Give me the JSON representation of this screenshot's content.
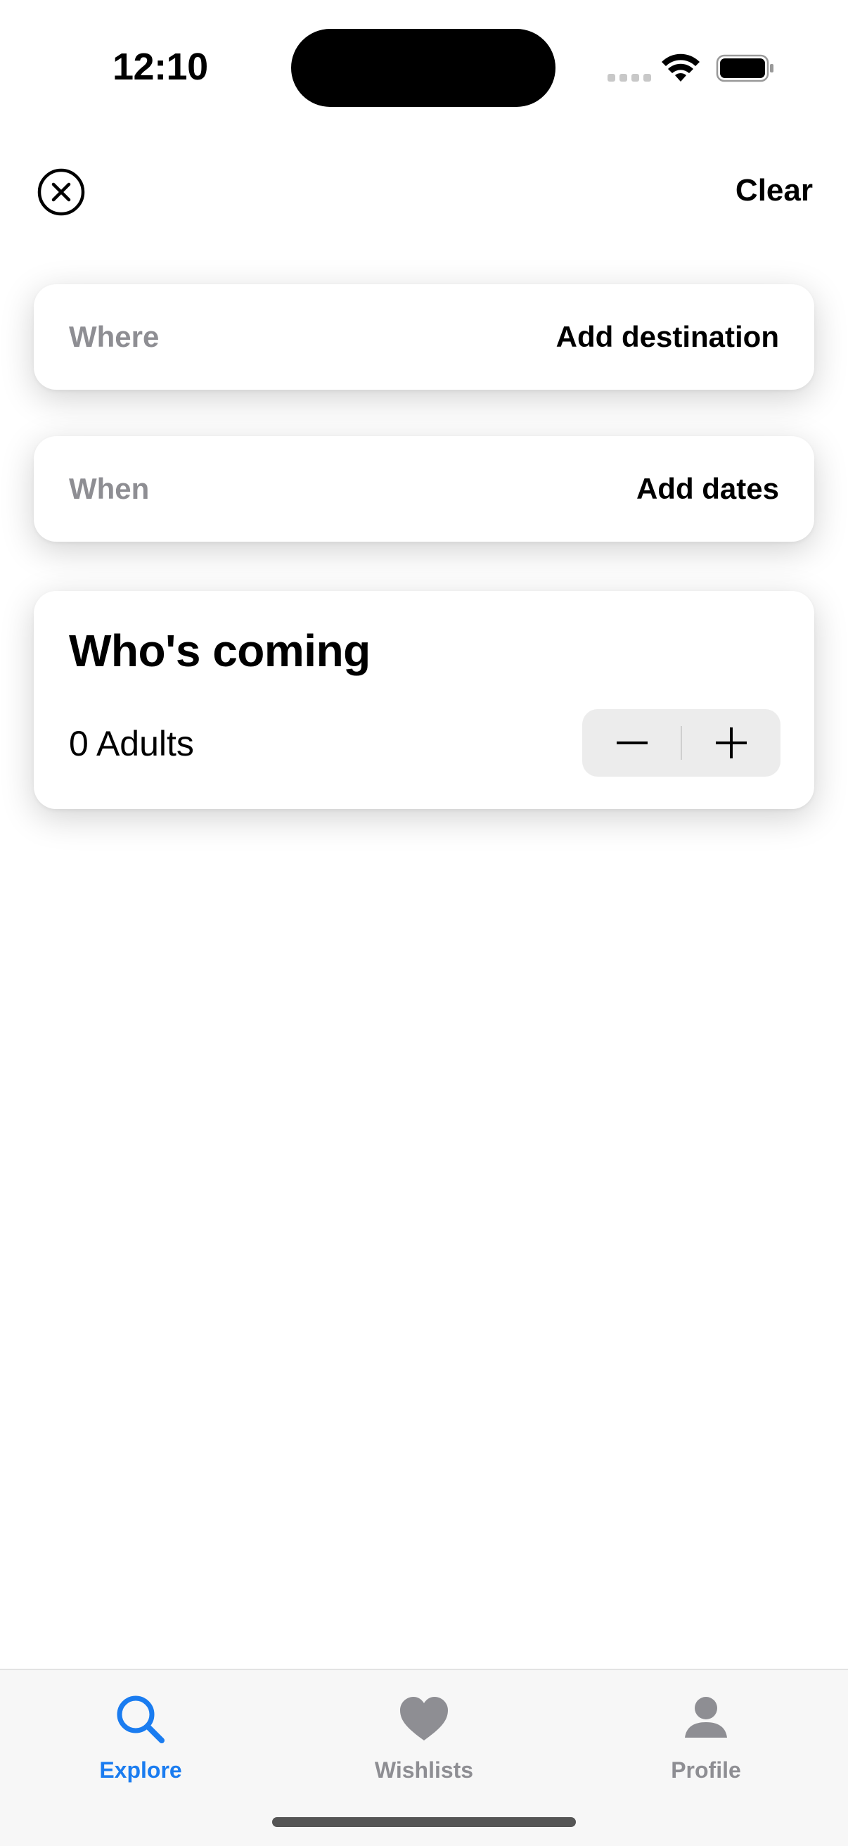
{
  "status_bar": {
    "time": "12:10"
  },
  "header": {
    "close_icon": "close-circle-icon",
    "clear_label": "Clear"
  },
  "search": {
    "where": {
      "label": "Where",
      "value": "Add destination"
    },
    "when": {
      "label": "When",
      "value": "Add dates"
    },
    "who": {
      "title": "Who's coming",
      "adults_text": "0 Adults"
    }
  },
  "tab_bar": {
    "active_color": "#1a7cf0",
    "inactive_color": "#8e8e93",
    "tabs": [
      {
        "label": "Explore",
        "icon": "magnifying-glass-icon",
        "active": true
      },
      {
        "label": "Wishlists",
        "icon": "heart-icon",
        "active": false
      },
      {
        "label": "Profile",
        "icon": "person-icon",
        "active": false
      }
    ]
  }
}
